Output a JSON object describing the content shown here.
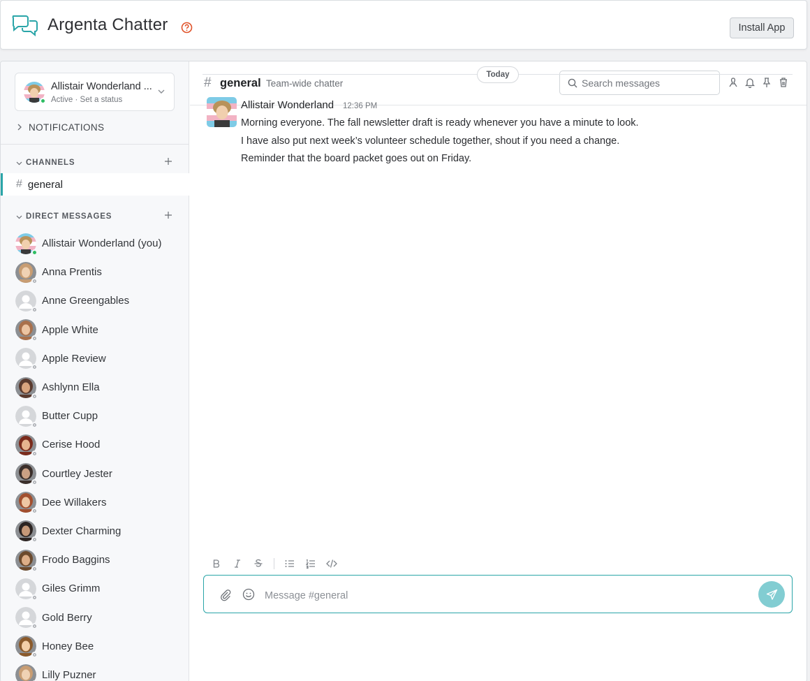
{
  "app": {
    "title": "Argenta Chatter",
    "install_label": "Install App",
    "accent": "#2aa5a8"
  },
  "sidebar": {
    "user": {
      "name": "Allistair Wonderland ...",
      "status": "Active · Set a status"
    },
    "notifications_label": "NOTIFICATIONS",
    "channels_label": "CHANNELS",
    "channels": [
      {
        "name": "general",
        "active": true
      }
    ],
    "dm_label": "DIRECT MESSAGES",
    "dms": [
      {
        "name": "Allistair Wonderland (you)",
        "online": true,
        "avatar": "photo"
      },
      {
        "name": "Anna Prentis",
        "online": false,
        "avatar": "photo"
      },
      {
        "name": "Anne Greengables",
        "online": false,
        "avatar": "default"
      },
      {
        "name": "Apple White",
        "online": false,
        "avatar": "photo"
      },
      {
        "name": "Apple Review",
        "online": false,
        "avatar": "default"
      },
      {
        "name": "Ashlynn Ella",
        "online": false,
        "avatar": "photo"
      },
      {
        "name": "Butter Cupp",
        "online": false,
        "avatar": "default"
      },
      {
        "name": "Cerise Hood",
        "online": false,
        "avatar": "photo"
      },
      {
        "name": "Courtley Jester",
        "online": false,
        "avatar": "photo"
      },
      {
        "name": "Dee Willakers",
        "online": false,
        "avatar": "photo"
      },
      {
        "name": "Dexter Charming",
        "online": false,
        "avatar": "photo"
      },
      {
        "name": "Frodo Baggins",
        "online": false,
        "avatar": "photo"
      },
      {
        "name": "Giles Grimm",
        "online": false,
        "avatar": "default"
      },
      {
        "name": "Gold Berry",
        "online": false,
        "avatar": "default"
      },
      {
        "name": "Honey Bee",
        "online": false,
        "avatar": "photo"
      },
      {
        "name": "Lilly Puzner",
        "online": false,
        "avatar": "photo"
      }
    ]
  },
  "channel": {
    "name": "general",
    "topic": "Team-wide chatter",
    "search_placeholder": "Search messages"
  },
  "messages": {
    "day_label": "Today",
    "items": [
      {
        "author": "Allistair Wonderland",
        "time": "12:36 PM",
        "lines": [
          "Morning everyone. The fall newsletter draft is ready whenever you have a minute to look.",
          "I have also put next week’s volunteer schedule together, shout if you need a change.",
          "Reminder that the board packet goes out on Friday."
        ]
      }
    ]
  },
  "composer": {
    "placeholder": "Message #general",
    "format_buttons": [
      "bold-icon",
      "italic-icon",
      "strikethrough-icon",
      "bullet-list-icon",
      "numbered-list-icon",
      "code-icon"
    ]
  }
}
